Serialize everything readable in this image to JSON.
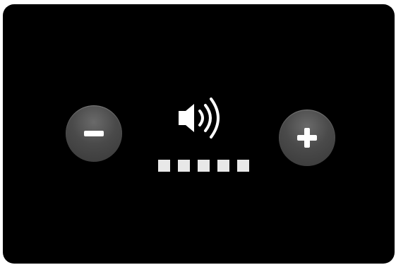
{
  "volume_hud": {
    "level": 5,
    "max_level": 5,
    "icons": {
      "decrease": "minus-icon",
      "increase": "plus-icon",
      "speaker": "speaker-volume-icon"
    },
    "colors": {
      "background": "#000000",
      "button": "#4a4a4a",
      "glyph": "#ffffff",
      "segment_on": "#e8e8e8",
      "segment_off": "#3a3a3a"
    }
  }
}
